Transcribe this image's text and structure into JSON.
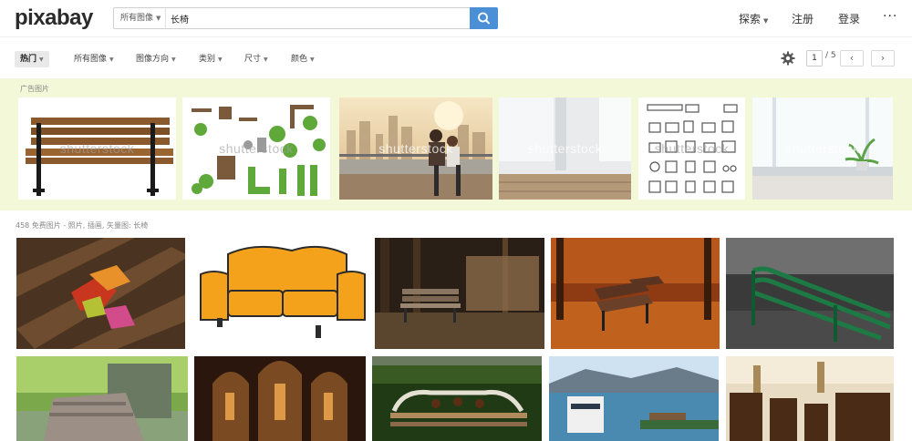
{
  "header": {
    "logo": "pixabay",
    "search_type": "所有图像",
    "search_value": "长椅",
    "nav": [
      "探索",
      "注册",
      "登录"
    ],
    "more": "···"
  },
  "filters": {
    "items": [
      "热门",
      "所有图像",
      "图像方向",
      "类别",
      "尺寸",
      "颜色"
    ],
    "page_current": "1",
    "page_total": "/ 5",
    "prev": "‹",
    "next": "›"
  },
  "ads": {
    "label": "广告图片",
    "watermark": "shutterstock"
  },
  "results": {
    "count_text": "458 免费图片 - 照片, 插画, 矢量图: 长椅"
  },
  "colors": {
    "accent": "#4b8fd6",
    "ads_background": "#f3f8d8"
  },
  "icons": [
    "search-icon",
    "gear-icon",
    "chevron-left-icon",
    "chevron-right-icon",
    "more-icon"
  ]
}
